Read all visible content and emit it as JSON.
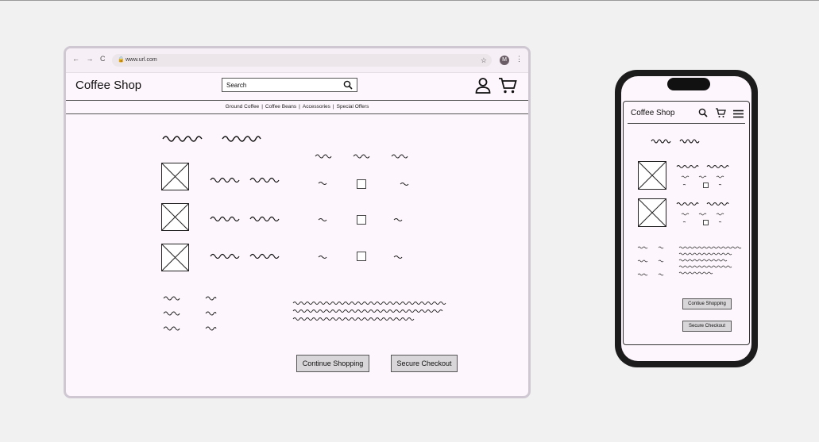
{
  "browser": {
    "url": "www.url.com",
    "avatar_initial": "M",
    "nav_buttons": "← → C"
  },
  "site": {
    "logo": "Coffee Shop",
    "search_placeholder": "Search",
    "categories": [
      "Ground Coffee",
      "Coffee Beans",
      "Accessories",
      "Special Offers"
    ]
  },
  "cart": {
    "continue_label": "Continue Shopping",
    "checkout_label": "Secure Checkout",
    "rows": 3
  },
  "phone": {
    "logo": "Coffee Shop",
    "continue_label": "Contiue Shopping",
    "checkout_label": "Secure Checkout",
    "rows": 2
  },
  "colors": {
    "page_bg": "#f1f1f1",
    "screen_bg": "#fdf6fc",
    "button_bg": "#d8d6d8",
    "frame": "#cfc8d2"
  }
}
